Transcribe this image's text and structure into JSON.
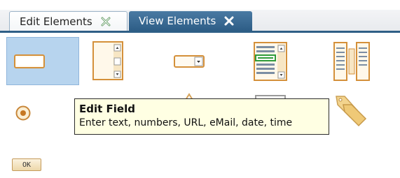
{
  "tabs": [
    {
      "label": "Edit Elements",
      "active": true,
      "close_icon": "close-tab-icon"
    },
    {
      "label": "View Elements",
      "active": false,
      "close_icon": "close-tab-icon"
    }
  ],
  "palette": [
    {
      "id": "edit-field",
      "icon": "edit-field-icon",
      "selected": true
    },
    {
      "id": "text-area",
      "icon": "scroll-textarea-icon",
      "selected": false
    },
    {
      "id": "dropdown",
      "icon": "dropdown-field-icon",
      "selected": false
    },
    {
      "id": "list-box",
      "icon": "list-box-icon",
      "selected": false
    },
    {
      "id": "dual-list",
      "icon": "dual-list-icon",
      "selected": false
    },
    {
      "id": "radio",
      "icon": "radio-button-icon",
      "selected": false
    },
    {
      "id": "tag",
      "icon": "tag-icon",
      "selected": false
    },
    {
      "id": "button",
      "icon": "ok-button-icon",
      "label": "OK",
      "selected": false
    }
  ],
  "tooltip": {
    "title": "Edit Field",
    "description": "Enter text, numbers, URL, eMail, date, time"
  },
  "colors": {
    "tab_active_bg": "#ffffff",
    "tab_inactive_bg": "#3a6a93",
    "tab_border": "#2f5f86",
    "selection_bg": "#b7d4ee",
    "tooltip_bg": "#ffffe3",
    "icon_orange": "#e0a24a"
  }
}
